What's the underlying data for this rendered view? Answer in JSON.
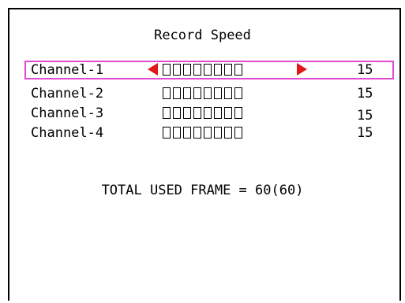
{
  "screen": {
    "title": "Record Speed",
    "total_label": "TOTAL USED FRAME = 60(60)",
    "accent_color": "#e24ad0",
    "arrow_color": "#e01818"
  },
  "channels": [
    {
      "label": "Channel-1",
      "value": "15",
      "selected": true,
      "blocks": 8
    },
    {
      "label": "Channel-2",
      "value": "15",
      "selected": false,
      "blocks": 8
    },
    {
      "label": "Channel-3",
      "value": "15",
      "selected": false,
      "blocks": 8
    },
    {
      "label": "Channel-4",
      "value": "15",
      "selected": false,
      "blocks": 8
    }
  ],
  "icons": {
    "decrease": "left-arrow-icon",
    "increase": "right-arrow-icon"
  }
}
